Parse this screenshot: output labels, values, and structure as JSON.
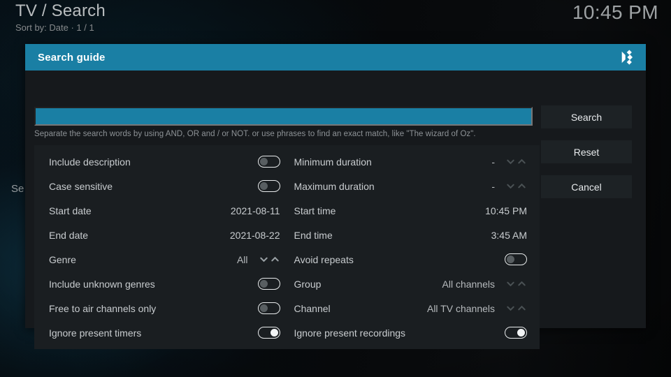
{
  "header": {
    "title": "TV / Search",
    "subtitle": "Sort by: Date  ·  1 / 1",
    "clock": "10:45 PM"
  },
  "background": {
    "list_text": "Se"
  },
  "dialog": {
    "title": "Search guide",
    "logo_icon": "kodi-logo",
    "search": {
      "value": "",
      "placeholder": "",
      "hint": "Separate the search words by using AND, OR and / or NOT. or use phrases to find an exact match, like \"The wizard of Oz\"."
    },
    "buttons": {
      "search": "Search",
      "reset": "Reset",
      "cancel": "Cancel"
    },
    "left_column": [
      {
        "label": "Include description",
        "type": "toggle",
        "value": "off"
      },
      {
        "label": "Case sensitive",
        "type": "toggle",
        "value": "off"
      },
      {
        "label": "Start date",
        "type": "value",
        "value": "2021-08-11"
      },
      {
        "label": "End date",
        "type": "value",
        "value": "2021-08-22"
      },
      {
        "label": "Genre",
        "type": "spinner",
        "value": "All",
        "highlight": true
      },
      {
        "label": "Include unknown genres",
        "type": "toggle",
        "value": "off"
      },
      {
        "label": "Free to air channels only",
        "type": "toggle",
        "value": "off"
      },
      {
        "label": "Ignore present timers",
        "type": "toggle",
        "value": "on"
      }
    ],
    "right_column": [
      {
        "label": "Minimum duration",
        "type": "spinner",
        "value": "-"
      },
      {
        "label": "Maximum duration",
        "type": "spinner",
        "value": "-"
      },
      {
        "label": "Start time",
        "type": "value",
        "value": "10:45 PM"
      },
      {
        "label": "End time",
        "type": "value",
        "value": "3:45 AM"
      },
      {
        "label": "Avoid repeats",
        "type": "toggle",
        "value": "off"
      },
      {
        "label": "Group",
        "type": "spinner",
        "value": "All channels"
      },
      {
        "label": "Channel",
        "type": "spinner",
        "value": "All TV channels"
      },
      {
        "label": "Ignore present recordings",
        "type": "toggle",
        "value": "on"
      }
    ]
  },
  "colors": {
    "accent": "#1a7fa4",
    "dialog_bg": "#16191c",
    "panel_bg": "#1a1e21",
    "button_bg": "#1d2225",
    "text": "#c8cccf"
  }
}
